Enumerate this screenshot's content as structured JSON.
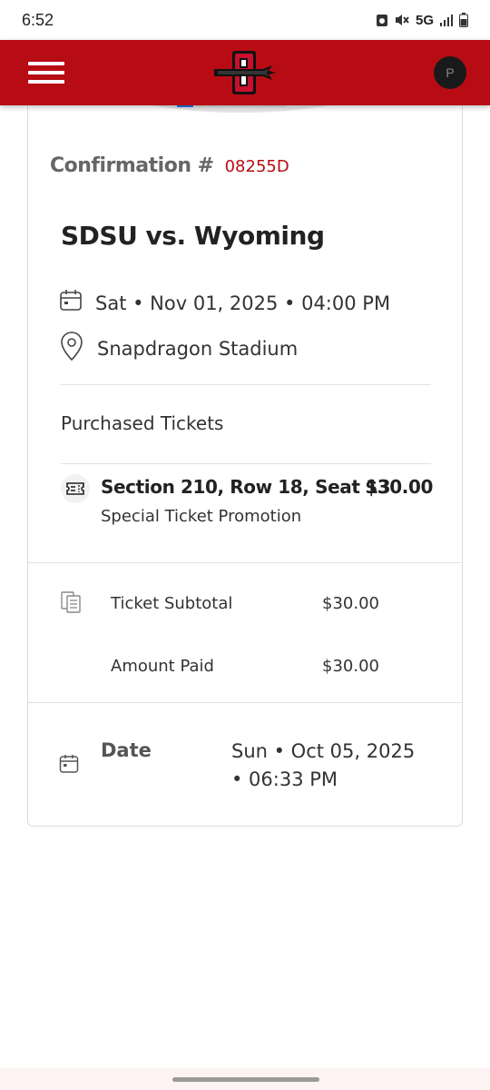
{
  "status_bar": {
    "time": "6:52",
    "network": "5G",
    "icons": [
      "notification-icon",
      "mute-icon",
      "signal-icon",
      "battery-icon"
    ]
  },
  "header": {
    "avatar_initial": "P",
    "icons": [
      "menu-icon",
      "sdsu-logo"
    ],
    "brand_color": "#b70c14"
  },
  "confirmation": {
    "label": "Confirmation #",
    "number": "08255D"
  },
  "event": {
    "title": "SDSU vs. Wyoming",
    "datetime": "Sat • Nov 01, 2025 • 04:00 PM",
    "venue": "Snapdragon Stadium"
  },
  "purchased": {
    "heading": "Purchased Tickets",
    "tickets": [
      {
        "section": "Section 210, Row 18, Seat 13",
        "price": "$30.00",
        "promo": "Special Ticket Promotion"
      }
    ]
  },
  "summary": {
    "subtotal_label": "Ticket Subtotal",
    "subtotal_value": "$30.00",
    "paid_label": "Amount Paid",
    "paid_value": "$30.00"
  },
  "order_date": {
    "label": "Date",
    "value": "Sun • Oct 05, 2025 • 06:33 PM"
  }
}
